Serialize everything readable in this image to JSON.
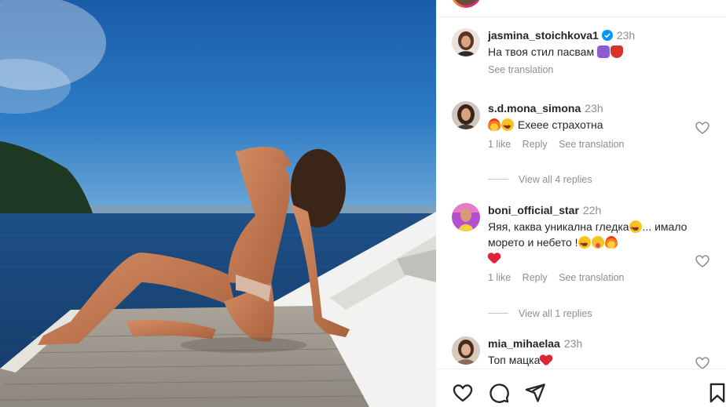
{
  "comments": [
    {
      "username": "jasmina_stoichkova1",
      "verified": true,
      "time": "23h",
      "text": "На твоя стил пасвам",
      "text_emojis": [
        "purple-emoji-icon",
        "red-face-emoji-icon"
      ],
      "see_translation": "See translation"
    },
    {
      "username": "s.d.mona_simona",
      "time": "23h",
      "text": "Ехеее страхотна",
      "text_emojis_before": [
        "fire-emoji-icon",
        "star-struck-emoji-icon"
      ],
      "likes": "1 like",
      "reply": "Reply",
      "see_translation": "See translation",
      "view_replies": "View all 4 replies"
    },
    {
      "username": "boni_official_star",
      "time": "22h",
      "text_part1": "Яяя, каква уникална гледка",
      "text_part2": "... имало морето и небето !",
      "likes": "1 like",
      "reply": "Reply",
      "see_translation": "See translation",
      "view_replies": "View all 1 replies"
    },
    {
      "username": "mia_mihaelaa",
      "time": "23h",
      "text": "Топ мацка"
    }
  ],
  "colors": {
    "verified_blue": "#0095f6",
    "secondary_text": "#8e8e8e",
    "primary_text": "#262626"
  },
  "actions": [
    "heart-icon",
    "comment-icon",
    "share-icon",
    "bookmark-icon"
  ]
}
